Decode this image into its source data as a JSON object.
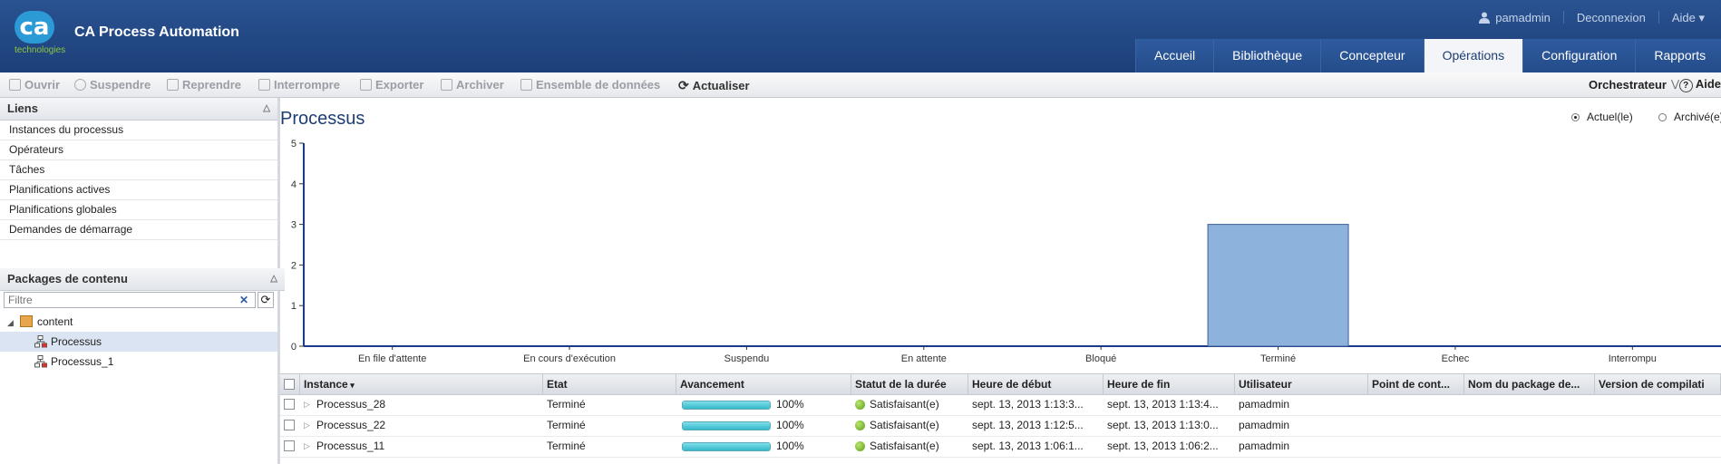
{
  "app": {
    "title": "CA Process Automation",
    "logo_text": "ca",
    "logo_sub": "technologies"
  },
  "header": {
    "user": "pamadmin",
    "logout": "Deconnexion",
    "help": "Aide"
  },
  "tabs": [
    {
      "label": "Accueil",
      "active": false
    },
    {
      "label": "Bibliothèque",
      "active": false
    },
    {
      "label": "Concepteur",
      "active": false
    },
    {
      "label": "Opérations",
      "active": true
    },
    {
      "label": "Configuration",
      "active": false
    },
    {
      "label": "Rapports",
      "active": false
    }
  ],
  "toolbar": {
    "open": "Ouvrir",
    "suspend": "Suspendre",
    "resume": "Reprendre",
    "interrupt": "Interrompre",
    "export": "Exporter",
    "archive": "Archiver",
    "dataset": "Ensemble de données",
    "refresh": "Actualiser",
    "orchestrator": "Orchestrateur",
    "help": "Aide"
  },
  "sidebar": {
    "links_title": "Liens",
    "links": [
      "Instances du processus",
      "Opérateurs",
      "Tâches",
      "Planifications actives",
      "Planifications globales",
      "Demandes de démarrage"
    ],
    "packages_title": "Packages de contenu",
    "filter_placeholder": "Filtre",
    "tree": [
      {
        "label": "content",
        "type": "package"
      },
      {
        "label": "Processus",
        "type": "process",
        "selected": true
      },
      {
        "label": "Processus_1",
        "type": "process",
        "selected": false
      }
    ]
  },
  "main": {
    "title": "Processus",
    "radio_current": "Actuel(le)",
    "radio_archived": "Archivé(e)"
  },
  "colors": {
    "bar": "#8db3dd",
    "axis": "#1a3a8a",
    "header": "#24498a"
  },
  "chart_data": {
    "type": "bar",
    "categories": [
      "En file d'attente",
      "En cours d'exécution",
      "Suspendu",
      "En attente",
      "Bloqué",
      "Terminé",
      "Echec",
      "Interrompu"
    ],
    "values": [
      0,
      0,
      0,
      0,
      0,
      3,
      0,
      0
    ],
    "yticks": [
      "0",
      "1",
      "2",
      "3",
      "4",
      "5"
    ],
    "ylim": [
      0,
      5
    ],
    "title": "",
    "xlabel": "",
    "ylabel": ""
  },
  "grid": {
    "columns": [
      "Instance",
      "Etat",
      "Avancement",
      "Statut de la durée",
      "Heure de début",
      "Heure de fin",
      "Utilisateur",
      "Point de cont...",
      "Nom du package de...",
      "Version de compilati"
    ],
    "rows": [
      {
        "instance": "Processus_28",
        "state": "Terminé",
        "progress": 1.0,
        "progress_text": "100%",
        "duration": "Satisfaisant(e)",
        "start": "sept. 13, 2013 1:13:3...",
        "end": "sept. 13, 2013 1:13:4...",
        "user": "pamadmin"
      },
      {
        "instance": "Processus_22",
        "state": "Terminé",
        "progress": 1.0,
        "progress_text": "100%",
        "duration": "Satisfaisant(e)",
        "start": "sept. 13, 2013 1:12:5...",
        "end": "sept. 13, 2013 1:13:0...",
        "user": "pamadmin"
      },
      {
        "instance": "Processus_11",
        "state": "Terminé",
        "progress": 1.0,
        "progress_text": "100%",
        "duration": "Satisfaisant(e)",
        "start": "sept. 13, 2013 1:06:1...",
        "end": "sept. 13, 2013 1:06:2...",
        "user": "pamadmin"
      }
    ]
  }
}
